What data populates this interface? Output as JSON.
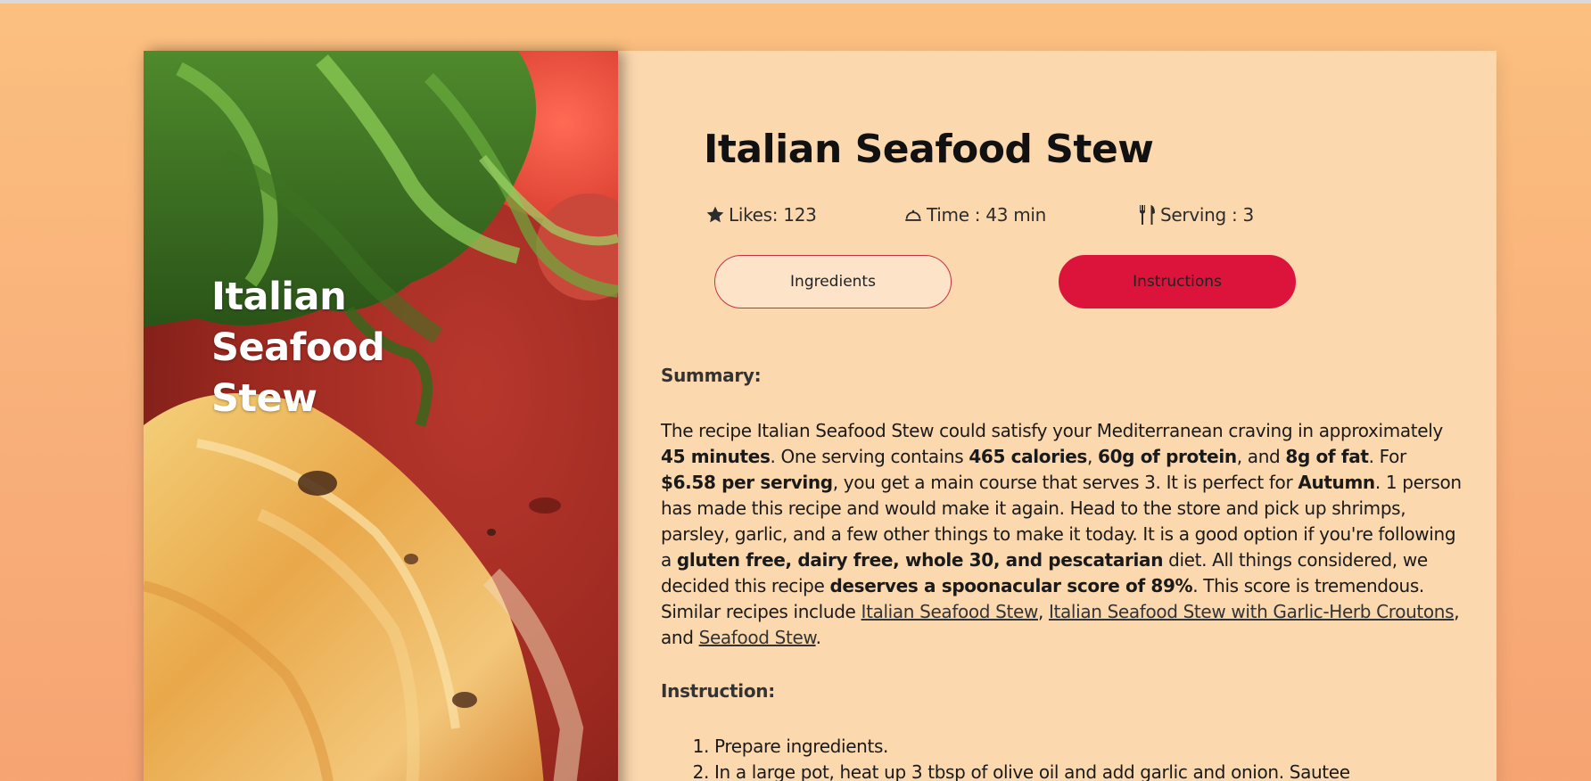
{
  "recipe": {
    "title": "Italian Seafood Stew",
    "hero_title_lines": [
      "Italian",
      "Seafood",
      "Stew"
    ]
  },
  "stats": {
    "likes": "Likes: 123",
    "time": "Time : 43 min",
    "serving": "Serving : 3"
  },
  "tabs": {
    "ingredients": "Ingredients",
    "instructions": "Instructions"
  },
  "summary": {
    "label": "Summary:",
    "segments": [
      {
        "t": "The recipe Italian Seafood Stew could satisfy your Mediterranean craving in approximately "
      },
      {
        "t": "45 minutes",
        "b": true
      },
      {
        "t": ". One serving contains "
      },
      {
        "t": "465 calories",
        "b": true
      },
      {
        "t": ", "
      },
      {
        "t": "60g of protein",
        "b": true
      },
      {
        "t": ", and "
      },
      {
        "t": "8g of fat",
        "b": true
      },
      {
        "t": ". For "
      },
      {
        "t": "$6.58 per serving",
        "b": true
      },
      {
        "t": ", you get a main course that serves 3. It is perfect for "
      },
      {
        "t": "Autumn",
        "b": true
      },
      {
        "t": ". 1 person has made this recipe and would make it again. Head to the store and pick up shrimps, parsley, garlic, and a few other things to make it today. It is a good option if you're following a "
      },
      {
        "t": "gluten free, dairy free, whole 30, and pescatarian",
        "b": true
      },
      {
        "t": " diet. All things considered, we decided this recipe "
      },
      {
        "t": "deserves a spoonacular score of 89%",
        "b": true
      },
      {
        "t": ". This score is tremendous. Similar recipes include "
      },
      {
        "t": "Italian Seafood Stew",
        "link": true
      },
      {
        "t": ", "
      },
      {
        "t": "Italian Seafood Stew with Garlic-Herb Croutons",
        "link": true
      },
      {
        "t": ", and "
      },
      {
        "t": "Seafood Stew",
        "link": true
      },
      {
        "t": "."
      }
    ]
  },
  "instruction": {
    "label": "Instruction:",
    "steps": [
      {
        "num": "1.",
        "text": "Prepare ingredients."
      },
      {
        "num": "2.",
        "text": "In a large pot, heat up 3 tbsp of olive oil and add garlic and onion. Sautee"
      }
    ]
  },
  "icons": {
    "likes": "star-icon",
    "time": "cloche-icon",
    "serving": "fork-knife-icon"
  },
  "colors": {
    "accent": "#dc143c",
    "content_bg": "#fcd8ae",
    "page_bg_top": "#fbc07f",
    "page_bg_bottom": "#f6a472"
  }
}
